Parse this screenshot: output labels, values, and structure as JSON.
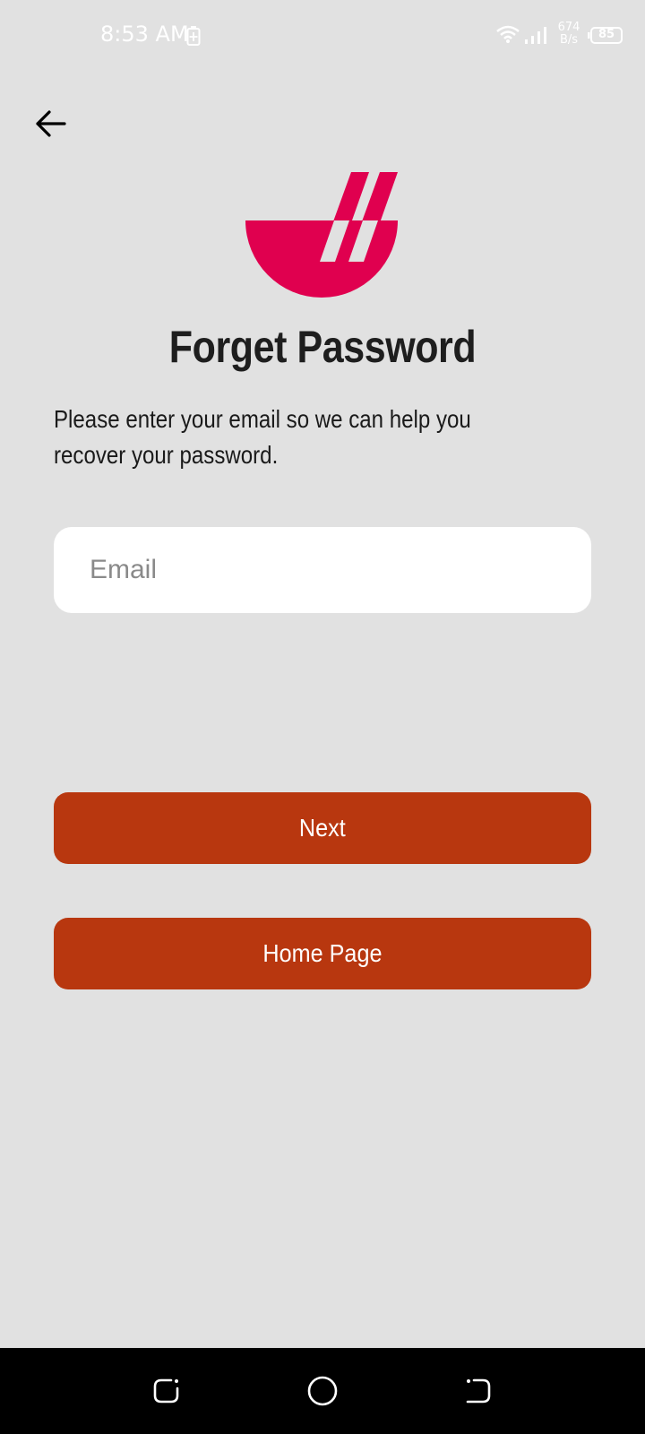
{
  "status_bar": {
    "time": "8:53 AM",
    "net_speed_value": "674",
    "net_speed_unit": "B/s",
    "battery_level": "85"
  },
  "page": {
    "title": "Forget Password",
    "description": "Please enter your email so we can help you recover your password."
  },
  "form": {
    "email_placeholder": "Email",
    "email_value": ""
  },
  "buttons": {
    "next_label": "Next",
    "home_label": "Home Page"
  },
  "colors": {
    "background": "#e1e1e1",
    "brand_logo": "#e0004f",
    "button": "#b8370f",
    "input_bg": "#ffffff",
    "nav_bar": "#000000"
  },
  "icons": {
    "back": "arrow-left-icon",
    "logo": "bowl-logo-icon",
    "nav_recents": "recents-icon",
    "nav_home": "home-circle-icon",
    "nav_back": "back-nav-icon"
  }
}
